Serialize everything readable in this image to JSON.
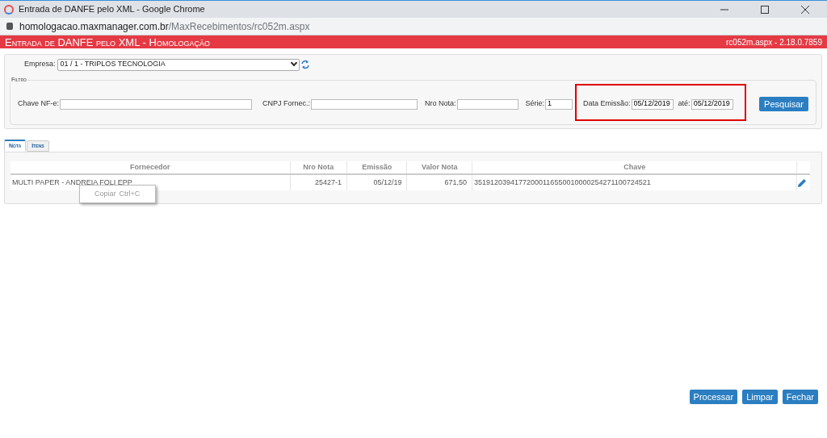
{
  "window": {
    "title": "Entrada de DANFE pelo XML - Google Chrome",
    "url_host": "homologacao.maxmanager.com.br",
    "url_path": "/MaxRecebimentos/rc052m.aspx"
  },
  "header": {
    "title": "Entrada de DANFE pelo XML  - Homologação",
    "version": "rc052m.aspx - 2.18.0.7859"
  },
  "empresa": {
    "label": "Empresa:",
    "value": "01 / 1 - TRIPLOS TECNOLOGIA"
  },
  "filter": {
    "legend": "Filtro",
    "date_range_highlighted": true,
    "fields": [
      {
        "label": "Chave NF-e:",
        "kind": "wide"
      },
      {
        "label": "CNPJ Fornec.:",
        "kind": "medium"
      },
      {
        "label": "Nro Nota:",
        "kind": "narrow"
      },
      {
        "label": "Série:",
        "value": "1",
        "kind": "small"
      },
      {
        "label": "Data Emissão:",
        "value": "05/12/2019",
        "kind": "date"
      },
      {
        "label": "até:",
        "value": "05/12/2019",
        "kind": "date"
      }
    ],
    "search_button": "Pesquisar"
  },
  "tabs": [
    {
      "label": "Nota",
      "selected": true
    },
    {
      "label": "Itens",
      "selected": false
    }
  ],
  "table": {
    "columns": [
      "Fornecedor",
      "Nro Nota",
      "Emissão",
      "Valor Nota",
      "Chave"
    ],
    "rows": [
      {
        "cells": [
          "MULTI PAPER - ANDREIA FOLI EPP",
          "25427-1",
          "05/12/19",
          "671,50",
          "35191203941772000116550010000254271100724521"
        ]
      }
    ]
  },
  "context_menu": {
    "label": "Copiar",
    "shortcut": "Ctrl+C"
  },
  "buttons": [
    "Processar",
    "Limpar",
    "Fechar"
  ]
}
